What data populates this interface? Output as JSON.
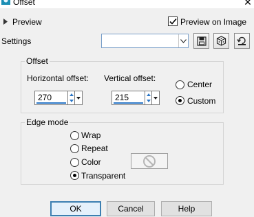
{
  "window": {
    "title": "Offset",
    "close_symbol": "✕"
  },
  "preview": {
    "label": "Preview",
    "on_image_label": "Preview on Image",
    "on_image_checked": true
  },
  "settings": {
    "label": "Settings",
    "value": ""
  },
  "offset_group": {
    "title": "Offset",
    "horizontal": {
      "label": "Horizontal offset:",
      "value": "270"
    },
    "vertical": {
      "label": "Vertical offset:",
      "value": "215"
    },
    "center_label": "Center",
    "custom_label": "Custom",
    "selected": "Custom"
  },
  "edge_group": {
    "title": "Edge mode",
    "options": [
      "Wrap",
      "Repeat",
      "Color",
      "Transparent"
    ],
    "selected": "Transparent"
  },
  "buttons": {
    "ok": "OK",
    "cancel": "Cancel",
    "help": "Help"
  },
  "colors": {
    "accent": "#2a76c6",
    "default_button_border": "#3c7fb1"
  }
}
